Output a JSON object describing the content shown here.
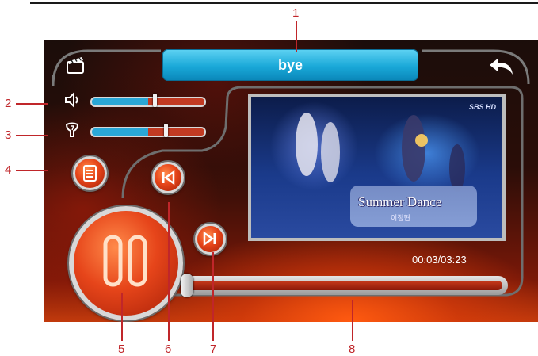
{
  "header": {
    "title": "bye"
  },
  "controls": {
    "volume_level": 0.56,
    "tone_level": 0.66,
    "elapsed_time": "00:03/03:23",
    "progress": 0.02
  },
  "video": {
    "caption": "Summer Dance",
    "caption_sub": "이정현",
    "channel_logo": "SBS HD"
  },
  "callouts": [
    "1",
    "2",
    "3",
    "4",
    "5",
    "6",
    "7",
    "8"
  ],
  "icons": {
    "clapperboard": "clapperboard-icon",
    "back": "back-arrow-icon",
    "volume": "speaker-icon",
    "tone": "tone-icon",
    "playlist": "playlist-icon",
    "prev": "previous-icon",
    "next": "next-icon",
    "pause": "pause-icon"
  },
  "colors": {
    "accent": "#19a8d8",
    "orb": "#e6451a",
    "callout": "#c0262a"
  }
}
